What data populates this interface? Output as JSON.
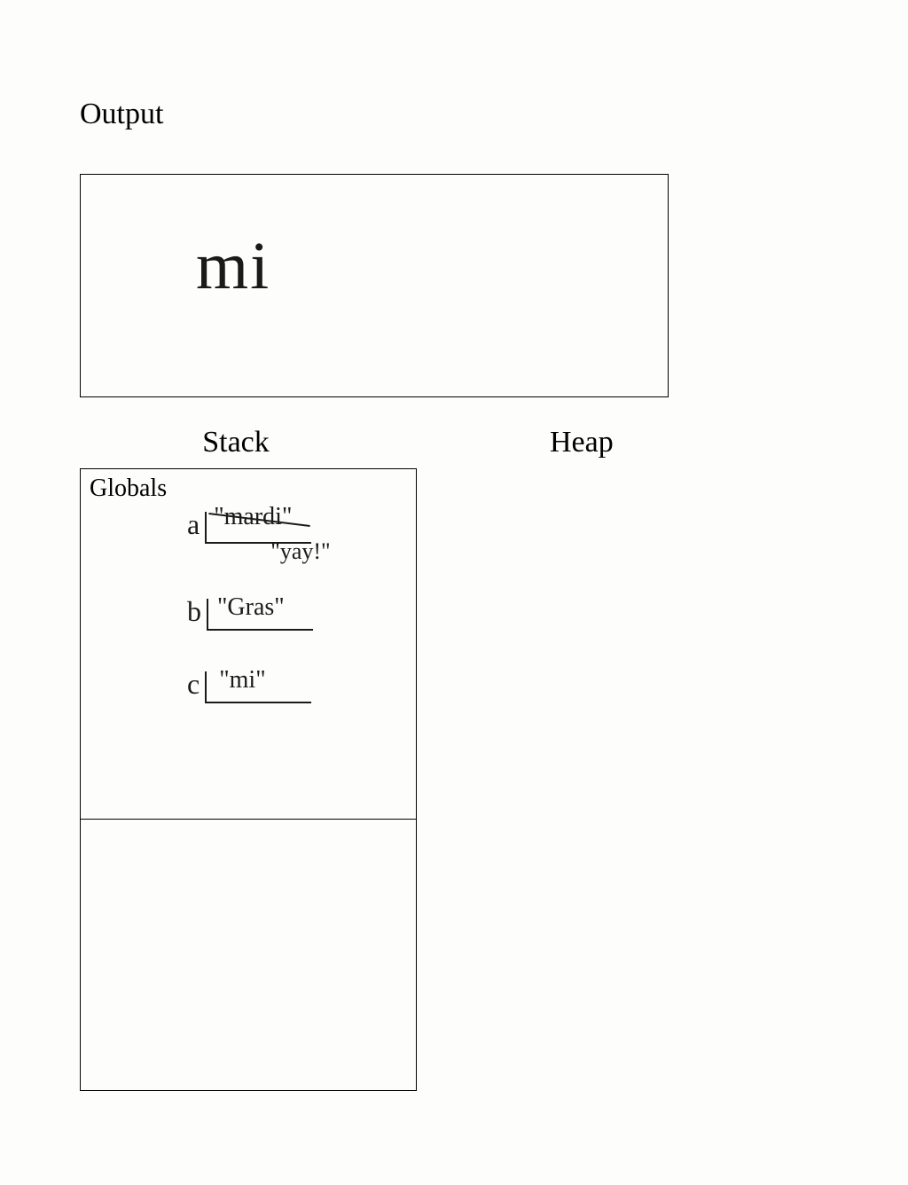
{
  "labels": {
    "output": "Output",
    "stack": "Stack",
    "heap": "Heap",
    "globals": "Globals"
  },
  "output": {
    "value": "mi"
  },
  "stack": {
    "globals": {
      "vars": [
        {
          "name": "a",
          "old_value": "\"mardi\"",
          "new_value": "\"yay!\""
        },
        {
          "name": "b",
          "value": "\"Gras\""
        },
        {
          "name": "c",
          "value": "\"mi\""
        }
      ]
    }
  }
}
